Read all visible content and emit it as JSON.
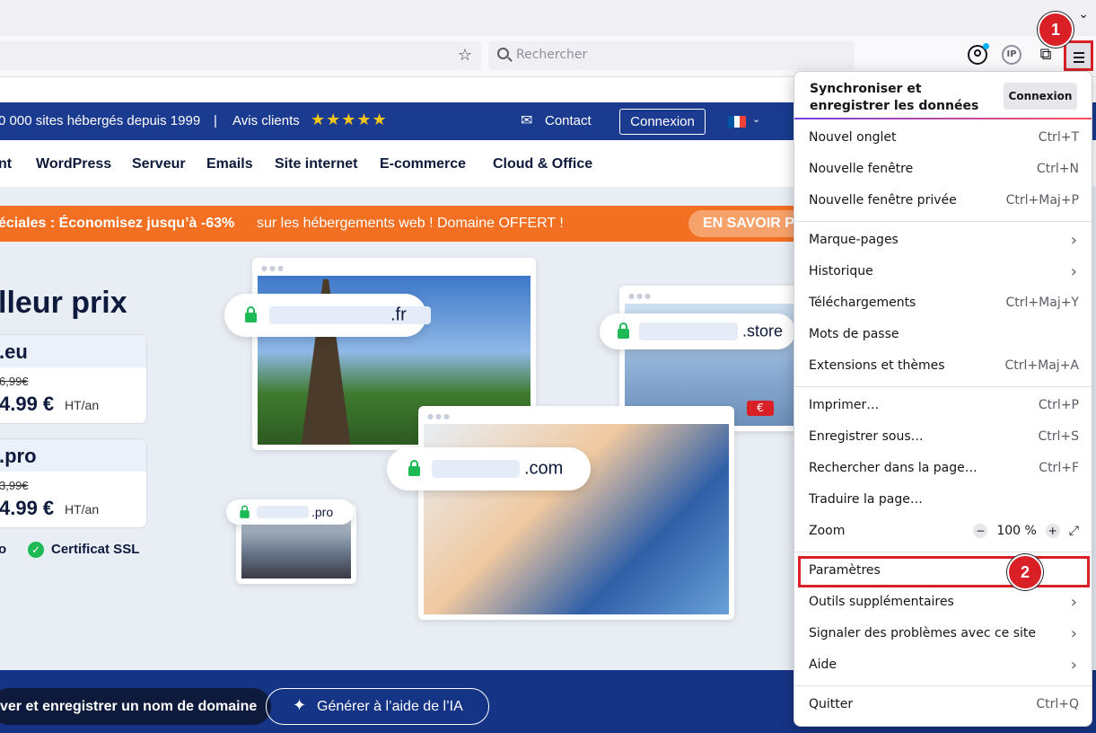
{
  "browser": {
    "search_placeholder": "Rechercher",
    "ip_icon_label": "IP"
  },
  "steps": {
    "one": "1",
    "two": "2"
  },
  "site": {
    "topbar": {
      "hosted_text": "0 000 sites hébergés depuis 1999",
      "separator": "|",
      "reviews_label": "Avis clients",
      "stars": "★★★★★",
      "contact_label": "Contact",
      "login_label": "Connexion"
    },
    "nav": [
      "nt",
      "WordPress",
      "Serveur",
      "Emails",
      "Site internet",
      "E-commerce",
      "Cloud & Office"
    ],
    "promo": {
      "bold": "éciales : Économisez jusqu’à -63%",
      "normal": "sur les hébergements web ! Domaine OFFERT !",
      "cta": "EN SAVOIR P"
    },
    "hero_title": "lleur prix",
    "price_cards": [
      {
        "ext": ".eu",
        "old_price": "6,99€",
        "price": "4.99 €",
        "unit": "HT/an"
      },
      {
        "ext": ".pro",
        "old_price": "3,99€",
        "price": "4.99 €",
        "unit": "HT/an"
      }
    ],
    "features": [
      "o",
      "Certificat SSL"
    ],
    "domain_pills": {
      "fr": ".fr",
      "store": ".store",
      "com": ".com",
      "pro": ".pro"
    },
    "euro_tag": "€",
    "bottom": {
      "register_label": "ver et enregistrer un nom de domaine",
      "ai_label": "Générer à l’aide de l’IA"
    }
  },
  "appmenu": {
    "sync_title": "Synchroniser et enregistrer les données",
    "sync_button": "Connexion",
    "items": {
      "new_tab": {
        "label": "Nouvel onglet",
        "shortcut": "Ctrl+T"
      },
      "new_window": {
        "label": "Nouvelle fenêtre",
        "shortcut": "Ctrl+N"
      },
      "private_window": {
        "label": "Nouvelle fenêtre privée",
        "shortcut": "Ctrl+Maj+P"
      },
      "bookmarks": {
        "label": "Marque-pages"
      },
      "history": {
        "label": "Historique"
      },
      "downloads": {
        "label": "Téléchargements",
        "shortcut": "Ctrl+Maj+Y"
      },
      "passwords": {
        "label": "Mots de passe"
      },
      "addons": {
        "label": "Extensions et thèmes",
        "shortcut": "Ctrl+Maj+A"
      },
      "print": {
        "label": "Imprimer…",
        "shortcut": "Ctrl+P"
      },
      "save_as": {
        "label": "Enregistrer sous…",
        "shortcut": "Ctrl+S"
      },
      "find": {
        "label": "Rechercher dans la page…",
        "shortcut": "Ctrl+F"
      },
      "translate": {
        "label": "Traduire la page…"
      },
      "zoom": {
        "label": "Zoom",
        "minus": "−",
        "value": "100 %",
        "plus": "+",
        "fullscreen": "⤢"
      },
      "settings": {
        "label": "Paramètres"
      },
      "more_tools": {
        "label": "Outils supplémentaires"
      },
      "report": {
        "label": "Signaler des problèmes avec ce site"
      },
      "help": {
        "label": "Aide"
      },
      "quit": {
        "label": "Quitter",
        "shortcut": "Ctrl+Q"
      }
    }
  },
  "colors": {
    "highlight_red": "#d92027",
    "site_blue": "#1a3b8f",
    "promo_orange": "#f36f21",
    "ssl_green": "#1db954"
  }
}
